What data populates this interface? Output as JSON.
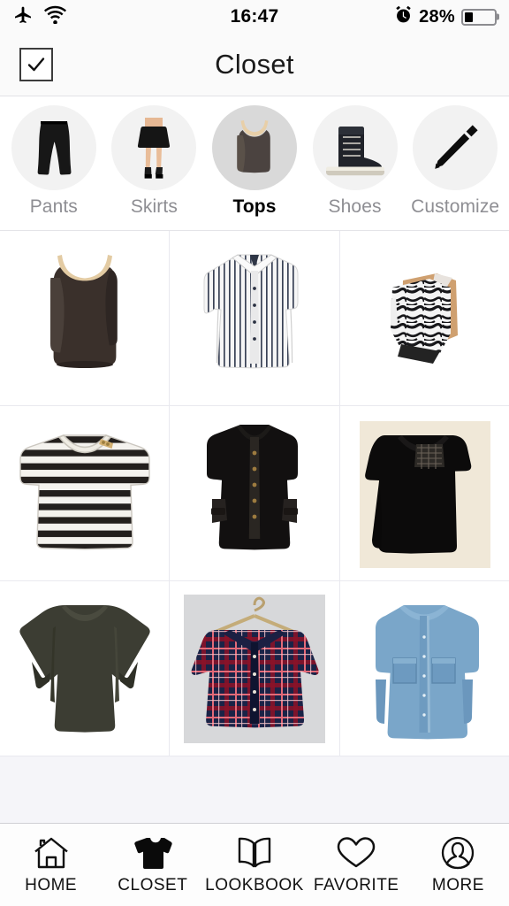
{
  "status_bar": {
    "airplane_icon": "airplane-icon",
    "wifi_icon": "wifi-icon",
    "time": "16:47",
    "alarm_icon": "alarm-clock-icon",
    "battery_percent": "28%",
    "battery_level": 28
  },
  "header": {
    "left_action": "select-checkbox",
    "title": "Closet"
  },
  "categories": [
    {
      "label": "Pants",
      "icon": "pants-thumbnail",
      "selected": false
    },
    {
      "label": "Skirts",
      "icon": "skirt-thumbnail",
      "selected": false
    },
    {
      "label": "Tops",
      "icon": "tank-top-thumbnail",
      "selected": true
    },
    {
      "label": "Shoes",
      "icon": "sneaker-thumbnail",
      "selected": false
    },
    {
      "label": "Customize",
      "icon": "pencil-icon",
      "selected": false
    }
  ],
  "grid": {
    "columns": 3,
    "items": [
      {
        "name": "brown-tank-top",
        "type": "tank",
        "color": "#3b312c"
      },
      {
        "name": "striped-white-shirt",
        "type": "shirt",
        "color": "#f2f2f2"
      },
      {
        "name": "zebra-print-top",
        "type": "zebra",
        "color": "#ffffff"
      },
      {
        "name": "striped-crop-tee",
        "type": "stripe-tee",
        "color": "#2b2724"
      },
      {
        "name": "black-button-blouse",
        "type": "blouse",
        "color": "#15130f"
      },
      {
        "name": "black-lace-sleeveless",
        "type": "sleeveless",
        "color": "#0d0c0c"
      },
      {
        "name": "olive-longsleeve-top",
        "type": "longsleeve",
        "color": "#3b3c32"
      },
      {
        "name": "plaid-flannel-shirt",
        "type": "plaid",
        "color": "#1b2445"
      },
      {
        "name": "denim-chambray-shirt",
        "type": "denim",
        "color": "#6e9cc4"
      }
    ]
  },
  "tabbar": [
    {
      "label": "HOME",
      "icon": "home-icon",
      "active": false
    },
    {
      "label": "CLOSET",
      "icon": "tshirt-icon",
      "active": true
    },
    {
      "label": "LOOKBOOK",
      "icon": "book-icon",
      "active": false
    },
    {
      "label": "FAVORITE",
      "icon": "heart-icon",
      "active": false
    },
    {
      "label": "MORE",
      "icon": "person-icon",
      "active": false
    }
  ],
  "colors": {
    "accent": "#000000",
    "inactive_text": "#8e8e93",
    "page_bg": "#f5f5f9",
    "divider": "#e9e9ef"
  }
}
